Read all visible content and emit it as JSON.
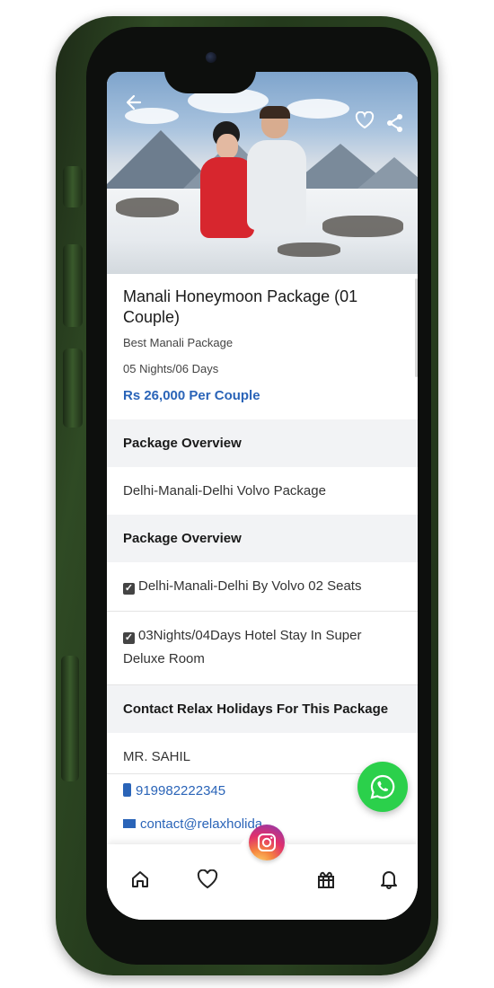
{
  "hero": {
    "back_icon": "arrow-left-icon",
    "favorite_icon": "heart-outline-icon",
    "share_icon": "share-icon"
  },
  "package": {
    "title": "Manali Honeymoon Package (01 Couple)",
    "category": "Best Manali Package",
    "duration": "05 Nights/06 Days",
    "price": "Rs 26,000 Per Couple"
  },
  "overview": {
    "heading": "Package Overview",
    "text": "Delhi-Manali-Delhi Volvo Package"
  },
  "inclusions": {
    "heading": "Package Overview",
    "items": [
      "Delhi-Manali-Delhi By Volvo 02 Seats",
      "03Nights/04Days Hotel Stay In Super Deluxe Room"
    ]
  },
  "contact": {
    "heading": "Contact Relax Holidays For This Package",
    "name": "MR. SAHIL",
    "phone": "919982222345",
    "email": "contact@relaxholida"
  },
  "fab": {
    "icon": "whatsapp-icon",
    "color": "#2bd04b"
  },
  "nav": {
    "items": [
      {
        "icon": "home-icon"
      },
      {
        "icon": "heart-icon"
      },
      {
        "icon": "instagram-icon"
      },
      {
        "icon": "gift-icon"
      },
      {
        "icon": "bell-icon"
      }
    ]
  },
  "colors": {
    "accent": "#2a64b8",
    "phone_body": "#2f4a24"
  }
}
